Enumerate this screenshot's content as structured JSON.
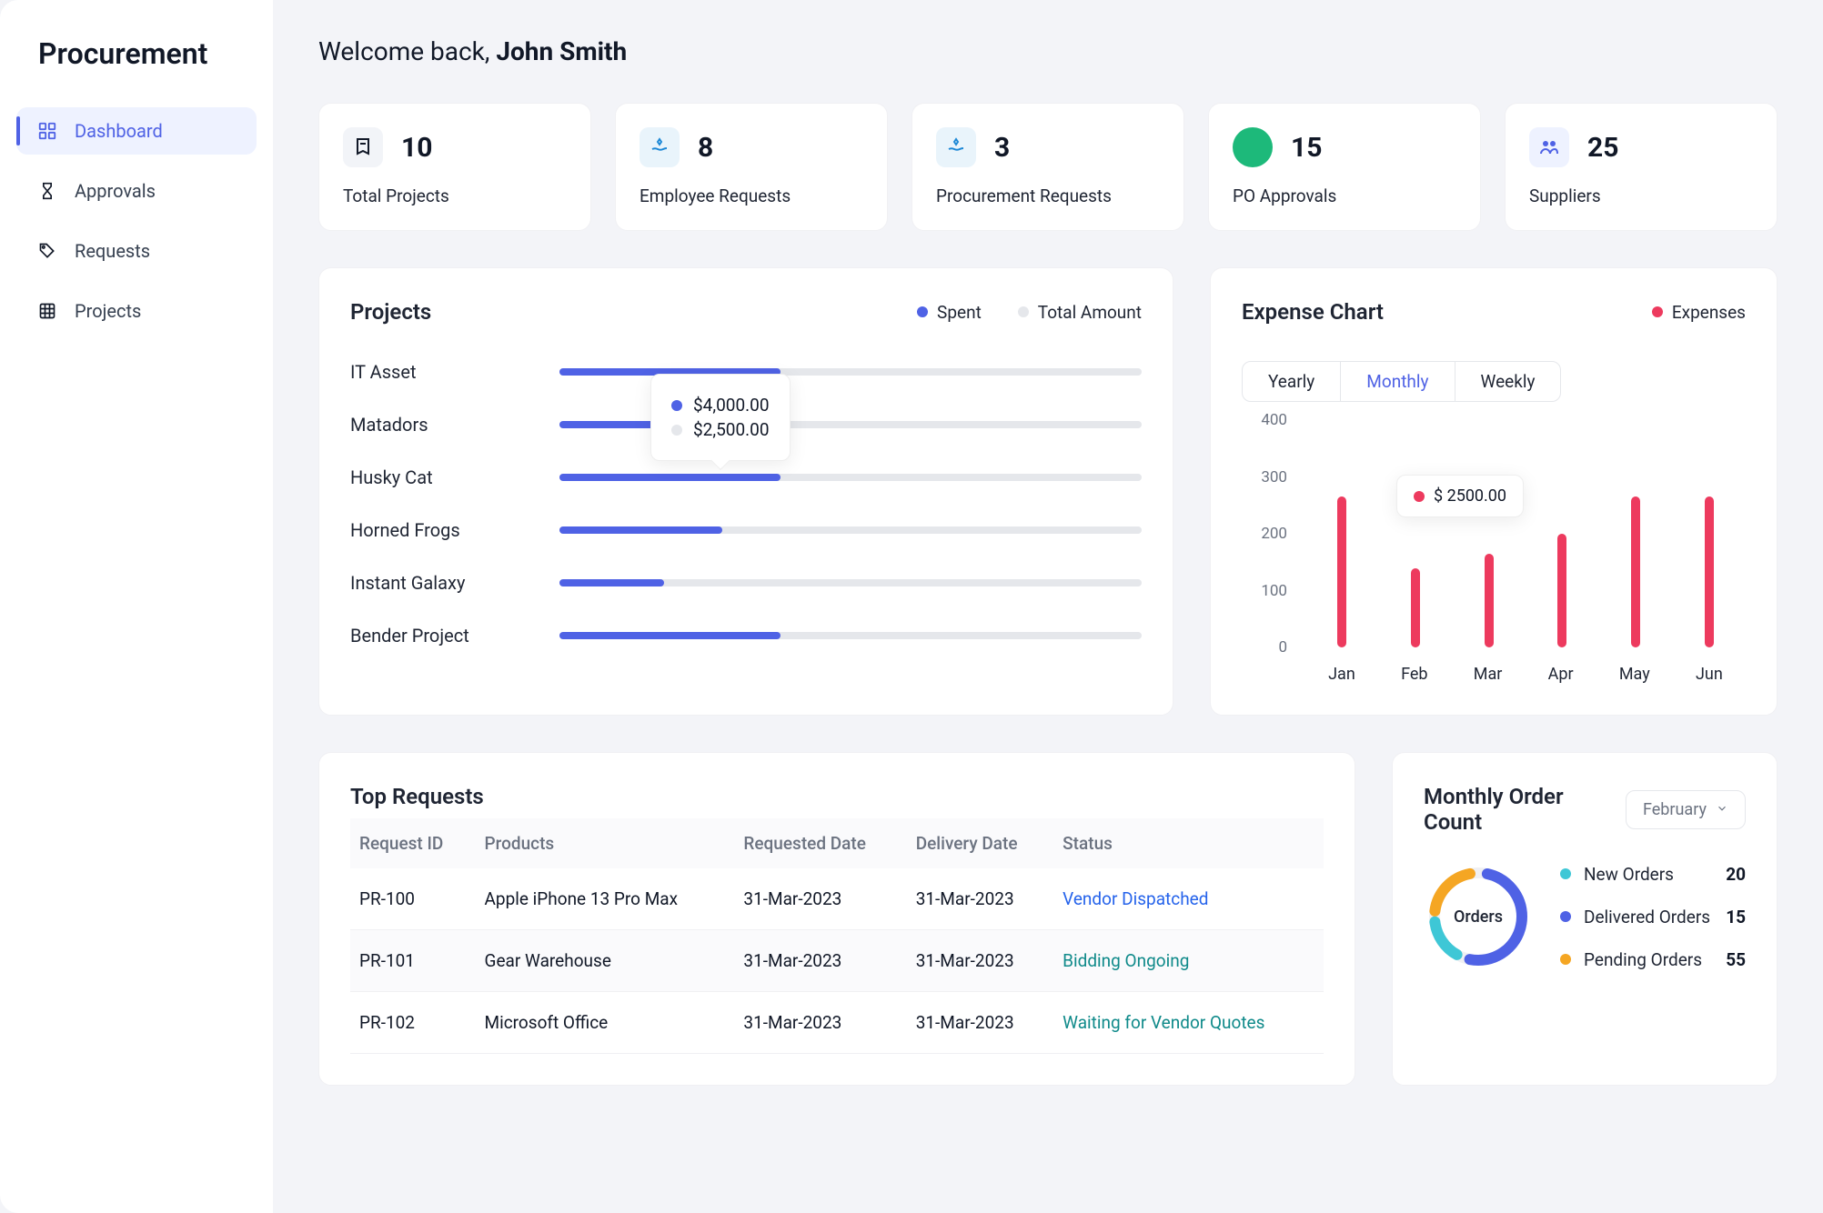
{
  "brand": "Procurement",
  "sidebar": {
    "items": [
      {
        "label": "Dashboard",
        "active": true
      },
      {
        "label": "Approvals"
      },
      {
        "label": "Requests"
      },
      {
        "label": "Projects"
      }
    ]
  },
  "welcome": {
    "prefix": "Welcome back, ",
    "name": "John Smith"
  },
  "stats": [
    {
      "value": "10",
      "label": "Total Projects",
      "icon_bg": "#F2F4F8",
      "icon_color": "#111827"
    },
    {
      "value": "8",
      "label": "Employee Requests",
      "icon_bg": "#E9F4FB",
      "icon_color": "#1D88D6"
    },
    {
      "value": "3",
      "label": "Procurement Requests",
      "icon_bg": "#E9F4FB",
      "icon_color": "#1D88D6"
    },
    {
      "value": "15",
      "label": "PO Approvals",
      "icon_bg": "#1DB97A",
      "icon_color": "#fff",
      "circle": true
    },
    {
      "value": "25",
      "label": "Suppliers",
      "icon_bg": "#EEF2FF",
      "icon_color": "#4F62E5"
    }
  ],
  "projects_card": {
    "title": "Projects",
    "legend": [
      {
        "color": "#4F62E5",
        "label": "Spent"
      },
      {
        "color": "#E5E7EB",
        "label": "Total Amount"
      }
    ],
    "tooltip": {
      "rows": [
        {
          "color": "#4F62E5",
          "value": "$4,000.00"
        },
        {
          "color": "#E5E7EB",
          "value": "$2,500.00"
        }
      ]
    }
  },
  "expense_card": {
    "title": "Expense Chart",
    "legend": {
      "color": "#ED3A5E",
      "label": "Expenses"
    },
    "tabs": [
      "Yearly",
      "Monthly",
      "Weekly"
    ],
    "active_tab": "Monthly",
    "tooltip": "$ 2500.00"
  },
  "requests_card": {
    "title": "Top Requests",
    "columns": [
      "Request ID",
      "Products",
      "Requested Date",
      "Delivery Date",
      "Status"
    ],
    "rows": [
      {
        "id": "PR-100",
        "product": "Apple iPhone 13 Pro Max",
        "req": "31-Mar-2023",
        "del": "31-Mar-2023",
        "status": "Vendor Dispatched",
        "status_color": "blue"
      },
      {
        "id": "PR-101",
        "product": "Gear Warehouse",
        "req": "31-Mar-2023",
        "del": "31-Mar-2023",
        "status": "Bidding Ongoing",
        "status_color": "teal"
      },
      {
        "id": "PR-102",
        "product": "Microsoft Office",
        "req": "31-Mar-2023",
        "del": "31-Mar-2023",
        "status": "Waiting for Vendor Quotes",
        "status_color": "teal"
      }
    ]
  },
  "order_card": {
    "title": "Monthly Order Count",
    "month": "February",
    "center_label": "Orders",
    "items": [
      {
        "color": "#3EC7D6",
        "label": "New Orders",
        "value": "20"
      },
      {
        "color": "#4F62E5",
        "label": "Delivered Orders",
        "value": "15"
      },
      {
        "color": "#F5A623",
        "label": "Pending Orders",
        "value": "55"
      }
    ]
  },
  "chart_data": [
    {
      "type": "bar",
      "title": "Projects",
      "orientation": "horizontal",
      "categories": [
        "IT Asset",
        "Matadors",
        "Husky Cat",
        "Horned Frogs",
        "Instant Galaxy",
        "Bender Project"
      ],
      "series": [
        {
          "name": "Spent (%)",
          "values": [
            38,
            20,
            38,
            28,
            18,
            38
          ]
        }
      ],
      "xlim": [
        0,
        100
      ],
      "tooltip_values": {
        "Spent": "$4,000.00",
        "Total Amount": "$2,500.00"
      }
    },
    {
      "type": "bar",
      "title": "Expense Chart",
      "categories": [
        "Jan",
        "Feb",
        "Mar",
        "Apr",
        "May",
        "Jun"
      ],
      "series": [
        {
          "name": "Expenses",
          "values": [
            265,
            140,
            165,
            200,
            265,
            265
          ]
        }
      ],
      "ylim": [
        0,
        400
      ],
      "ylabel": "",
      "tooltip": "$ 2500.00"
    },
    {
      "type": "pie",
      "title": "Monthly Order Count",
      "categories": [
        "New Orders",
        "Delivered Orders",
        "Pending Orders"
      ],
      "values": [
        20,
        15,
        55
      ],
      "colors": [
        "#3EC7D6",
        "#4F62E5",
        "#F5A623"
      ]
    }
  ]
}
